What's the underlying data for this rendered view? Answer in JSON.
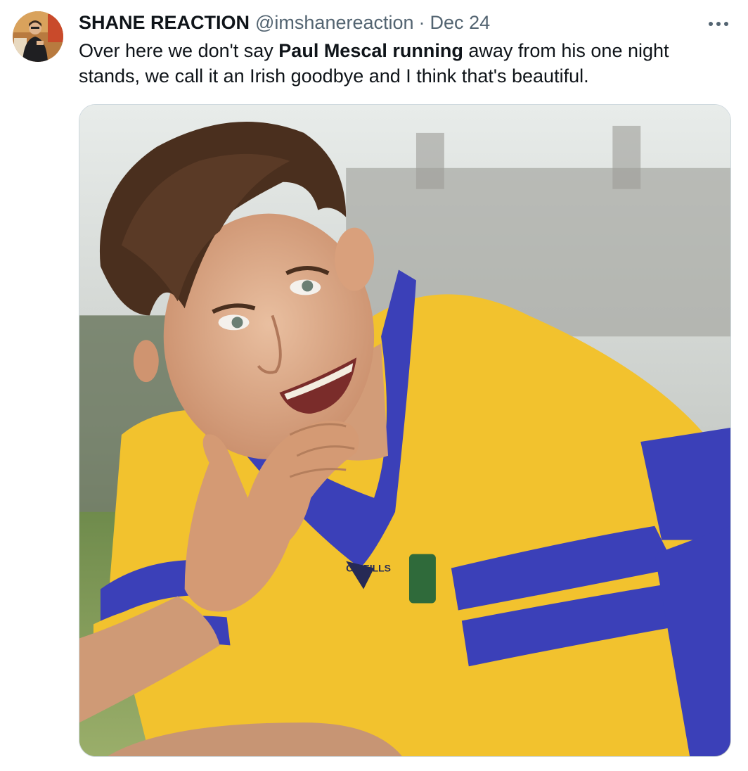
{
  "tweet": {
    "author": {
      "display_name": "SHANE REACTION",
      "handle": "@imshanereaction"
    },
    "separator": "·",
    "date": "Dec 24",
    "more_icon": "more-horizontal-icon",
    "text": {
      "before": "Over here we don't say ",
      "bold": "Paul Mescal running",
      "after": " away from his one night stands, we call it an Irish goodbye and I think that's beautiful."
    },
    "media": {
      "jersey_text": "O'NEILLS",
      "colors": {
        "jersey_yellow": "#f2c22e",
        "jersey_blue": "#3b40b8",
        "sky": "#e4e8e6",
        "grass": "#7e9a55"
      }
    }
  }
}
